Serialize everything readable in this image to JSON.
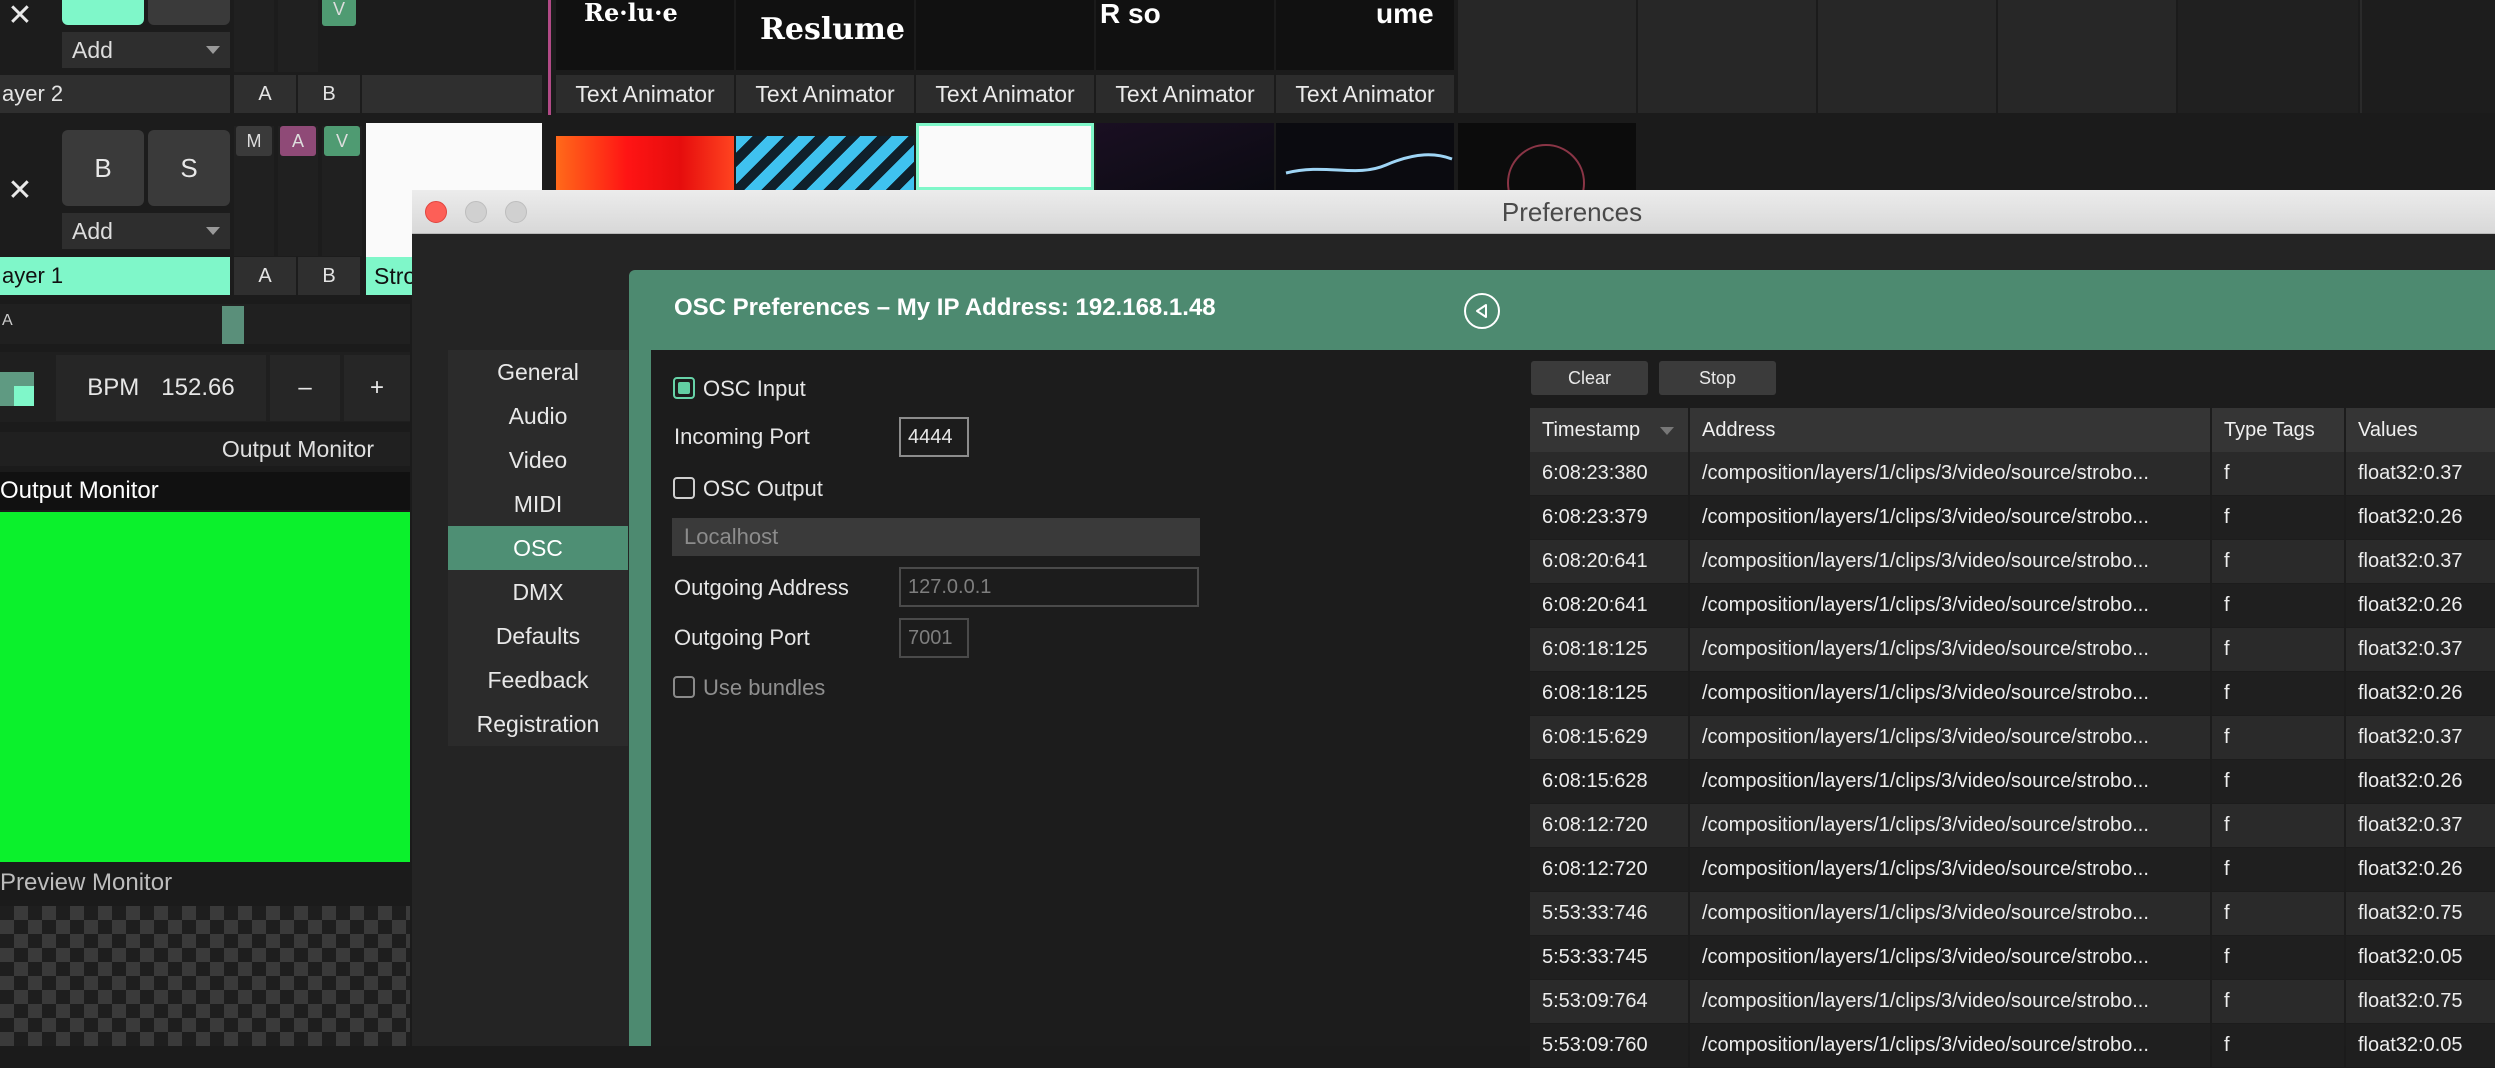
{
  "app": {
    "layers": [
      {
        "name": "ayer 2",
        "add_label": "Add",
        "a": "A",
        "b": "B",
        "v": "V"
      },
      {
        "name": "ayer 1",
        "add_label": "Add",
        "a": "A",
        "b": "B",
        "blend_b": "B",
        "solo_s": "S",
        "m": "M",
        "mini_a": "A",
        "v": "V",
        "partial_clip_label": "Stro"
      }
    ],
    "clips_row2": {
      "labels": [
        "Text Animator",
        "Text Animator",
        "Text Animator",
        "Text Animator",
        "Text Animator"
      ],
      "thumb_texts": [
        "Re·lu·e",
        "Reslume",
        "",
        "R   so",
        "ume"
      ]
    },
    "crossfader_label": "A",
    "bpm_label": "BPM",
    "bpm_value": "152.66",
    "bpm_minus": "–",
    "bpm_plus": "+",
    "output_monitor_header": "Output Monitor",
    "output_monitor_title": "Output Monitor",
    "preview_monitor_title": "Preview Monitor",
    "colors": {
      "output_green": "#0bf12c",
      "accent": "#4d8a70",
      "layer_active": "#7ff7c9"
    }
  },
  "preferences": {
    "window_title": "Preferences",
    "header": "OSC Preferences – My IP Address: 192.168.1.48",
    "nav": [
      "General",
      "Audio",
      "Video",
      "MIDI",
      "OSC",
      "DMX",
      "Defaults",
      "Feedback",
      "Registration"
    ],
    "active_nav": "OSC",
    "osc_input": {
      "label": "OSC Input",
      "checked": true
    },
    "incoming_port": {
      "label": "Incoming Port",
      "value": "4444"
    },
    "osc_output": {
      "label": "OSC Output",
      "checked": false
    },
    "target": "Localhost",
    "outgoing_address": {
      "label": "Outgoing Address",
      "value": "127.0.0.1"
    },
    "outgoing_port": {
      "label": "Outgoing Port",
      "value": "7001"
    },
    "use_bundles": {
      "label": "Use bundles",
      "checked": false
    },
    "buttons": {
      "clear": "Clear",
      "stop": "Stop"
    },
    "table": {
      "columns": [
        "Timestamp",
        "Address",
        "Type Tags",
        "Values"
      ],
      "rows": [
        {
          "ts": "6:08:23:380",
          "addr": "/composition/layers/1/clips/3/video/source/strobo...",
          "tt": "f",
          "val": "float32:0.37"
        },
        {
          "ts": "6:08:23:379",
          "addr": "/composition/layers/1/clips/3/video/source/strobo...",
          "tt": "f",
          "val": "float32:0.26"
        },
        {
          "ts": "6:08:20:641",
          "addr": "/composition/layers/1/clips/3/video/source/strobo...",
          "tt": "f",
          "val": "float32:0.37"
        },
        {
          "ts": "6:08:20:641",
          "addr": "/composition/layers/1/clips/3/video/source/strobo...",
          "tt": "f",
          "val": "float32:0.26"
        },
        {
          "ts": "6:08:18:125",
          "addr": "/composition/layers/1/clips/3/video/source/strobo...",
          "tt": "f",
          "val": "float32:0.37"
        },
        {
          "ts": "6:08:18:125",
          "addr": "/composition/layers/1/clips/3/video/source/strobo...",
          "tt": "f",
          "val": "float32:0.26"
        },
        {
          "ts": "6:08:15:629",
          "addr": "/composition/layers/1/clips/3/video/source/strobo...",
          "tt": "f",
          "val": "float32:0.37"
        },
        {
          "ts": "6:08:15:628",
          "addr": "/composition/layers/1/clips/3/video/source/strobo...",
          "tt": "f",
          "val": "float32:0.26"
        },
        {
          "ts": "6:08:12:720",
          "addr": "/composition/layers/1/clips/3/video/source/strobo...",
          "tt": "f",
          "val": "float32:0.37"
        },
        {
          "ts": "6:08:12:720",
          "addr": "/composition/layers/1/clips/3/video/source/strobo...",
          "tt": "f",
          "val": "float32:0.26"
        },
        {
          "ts": "5:53:33:746",
          "addr": "/composition/layers/1/clips/3/video/source/strobo...",
          "tt": "f",
          "val": "float32:0.75"
        },
        {
          "ts": "5:53:33:745",
          "addr": "/composition/layers/1/clips/3/video/source/strobo...",
          "tt": "f",
          "val": "float32:0.05"
        },
        {
          "ts": "5:53:09:764",
          "addr": "/composition/layers/1/clips/3/video/source/strobo...",
          "tt": "f",
          "val": "float32:0.75"
        },
        {
          "ts": "5:53:09:760",
          "addr": "/composition/layers/1/clips/3/video/source/strobo...",
          "tt": "f",
          "val": "float32:0.05"
        }
      ]
    }
  }
}
